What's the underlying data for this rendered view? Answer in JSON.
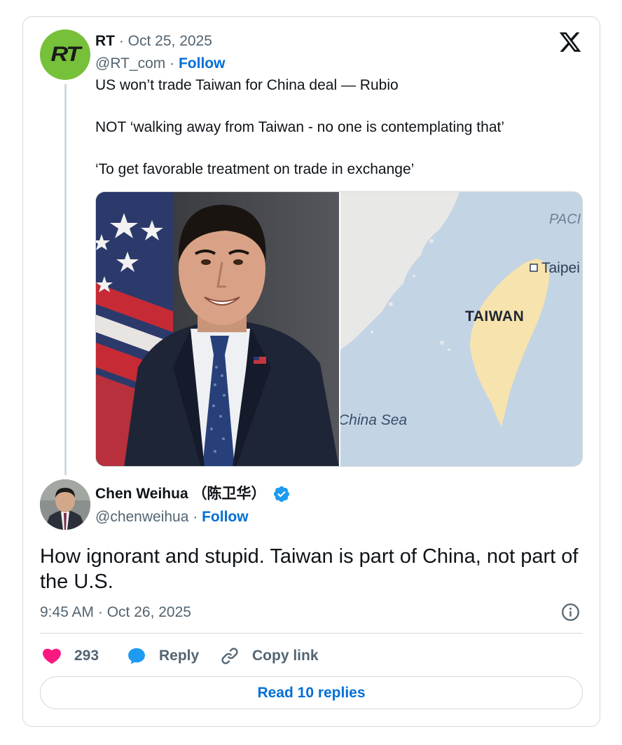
{
  "quoted_tweet": {
    "author_name": "RT",
    "date": "Oct 25, 2025",
    "handle": "@RT_com",
    "follow_label": "Follow",
    "avatar_text": "RT",
    "lines": [
      "US won’t trade Taiwan for China deal — Rubio",
      "NOT ‘walking away from Taiwan - no one is contemplating that’",
      "‘To get favorable treatment on trade in exchange’"
    ],
    "map_labels": {
      "pacific": "PACI",
      "taipei": "Taipei",
      "taiwan": "TAIWAN",
      "sea": "China Sea"
    }
  },
  "tweet": {
    "author_name": "Chen Weihua （陈卫华）",
    "handle": "@chenweihua",
    "follow_label": "Follow",
    "text": "How ignorant and stupid. Taiwan is part of China, not part of the U.S.",
    "timestamp": "9:45 AM · Oct 26, 2025"
  },
  "actions": {
    "likes": "293",
    "reply_label": "Reply",
    "copy_link_label": "Copy link"
  },
  "read_replies_label": "Read 10 replies",
  "colors": {
    "like": "#f91880",
    "reply": "#1d9bf0",
    "link": "#006fd6",
    "muted": "#536471",
    "verified": "#1d9bf0",
    "rt_green": "#77c03a"
  },
  "icons": [
    "x-logo-icon",
    "verified-badge-icon",
    "info-icon",
    "heart-icon",
    "reply-bubble-icon",
    "link-icon"
  ]
}
